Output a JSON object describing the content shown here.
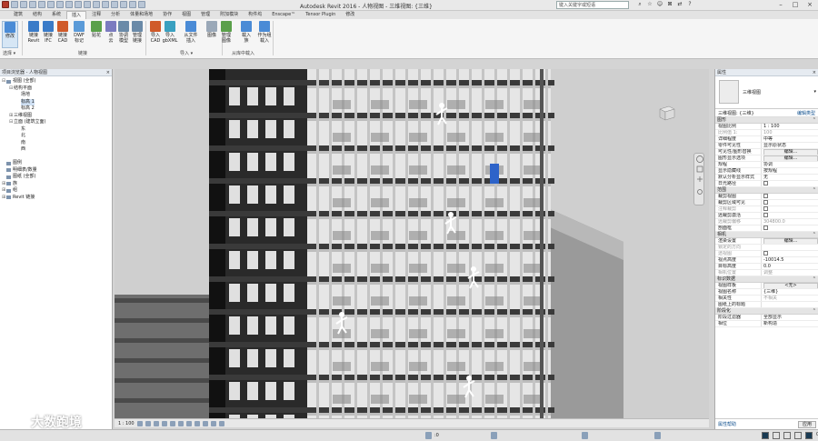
{
  "app": {
    "title": "Autodesk Revit 2016 -     人物视图 - 三维视图: {三维}",
    "search_placeholder": "键入关键字或短语",
    "window_controls": [
      "–",
      "□",
      "×"
    ]
  },
  "tabs": [
    "建筑",
    "结构",
    "系统",
    "插入",
    "注释",
    "分析",
    "体量和场地",
    "协作",
    "视图",
    "管理",
    "附加模块",
    "构件坞",
    "Enscape™",
    "Tensor Plugin",
    "修改"
  ],
  "active_tab_index": 3,
  "ribbon": {
    "buttons": [
      {
        "label": "修改",
        "icon": "modify-icon",
        "color": "#4a8bd6",
        "selected": true
      },
      {
        "label": "链接\nRevit",
        "icon": "link-revit-icon",
        "color": "#3a7bc8"
      },
      {
        "label": "链接\nIFC",
        "icon": "link-ifc-icon",
        "color": "#3a7bc8"
      },
      {
        "label": "链接\nCAD",
        "icon": "link-cad-icon",
        "color": "#d05a2a"
      },
      {
        "label": "DWF\n标记",
        "icon": "dwf-markup-icon",
        "color": "#5a9ad8"
      },
      {
        "label": "贴花",
        "icon": "decal-icon",
        "color": "#5aa04a"
      },
      {
        "label": "点\n云",
        "icon": "point-cloud-icon",
        "color": "#7b7bc0"
      },
      {
        "label": "协调\n模型",
        "icon": "coordination-model-icon",
        "color": "#6a8aa8"
      },
      {
        "label": "管理\n链接",
        "icon": "manage-links-icon",
        "color": "#6a8aa8"
      },
      {
        "label": "导入\nCAD",
        "icon": "import-cad-icon",
        "color": "#d05a2a"
      },
      {
        "label": "导入\ngbXML",
        "icon": "import-gbxml-icon",
        "color": "#3aa0c0"
      },
      {
        "label": "从文件\n插入",
        "icon": "insert-from-file-icon",
        "color": "#4a8bd6"
      },
      {
        "label": "图像",
        "icon": "image-icon",
        "color": "#9aa8b8"
      },
      {
        "label": "管理\n图像",
        "icon": "manage-images-icon",
        "color": "#5aa04a"
      },
      {
        "label": "载入\n族",
        "icon": "load-family-icon",
        "color": "#4a8bd6"
      },
      {
        "label": "作为组\n载入",
        "icon": "load-as-group-icon",
        "color": "#4a8bd6"
      }
    ],
    "panels": [
      "选择 ▾",
      "链接",
      "导入 ▾",
      "从库中载入"
    ]
  },
  "browser": {
    "title": "项目浏览器 - 人物视图",
    "close": "×",
    "tree": [
      {
        "level": 0,
        "toggle": "⊟",
        "text": "视图 (全部)",
        "icon": true
      },
      {
        "level": 1,
        "toggle": "⊟",
        "text": "结构平面",
        "icon": false
      },
      {
        "level": 2,
        "toggle": "",
        "text": "场地",
        "icon": false
      },
      {
        "level": 2,
        "toggle": "",
        "text": "标高 1",
        "icon": false,
        "selected": true
      },
      {
        "level": 2,
        "toggle": "",
        "text": "标高 2",
        "icon": false
      },
      {
        "level": 1,
        "toggle": "⊞",
        "text": "三维视图",
        "icon": false
      },
      {
        "level": 1,
        "toggle": "⊟",
        "text": "立面 (建筑立面)",
        "icon": false
      },
      {
        "level": 2,
        "toggle": "",
        "text": "东",
        "icon": false
      },
      {
        "level": 2,
        "toggle": "",
        "text": "北",
        "icon": false
      },
      {
        "level": 2,
        "toggle": "",
        "text": "南",
        "icon": false
      },
      {
        "level": 2,
        "toggle": "",
        "text": "西",
        "icon": false
      },
      {
        "level": 0,
        "toggle": "",
        "text": "",
        "icon": false
      },
      {
        "level": 0,
        "toggle": "",
        "text": "图例",
        "icon": true
      },
      {
        "level": 0,
        "toggle": "",
        "text": "明细表/数量",
        "icon": true
      },
      {
        "level": 0,
        "toggle": "",
        "text": "图纸 (全部)",
        "icon": true
      },
      {
        "level": 0,
        "toggle": "⊞",
        "text": "族",
        "icon": true
      },
      {
        "level": 0,
        "toggle": "⊞",
        "text": "组",
        "icon": true
      },
      {
        "level": 0,
        "toggle": "⊞",
        "text": "Revit 链接",
        "icon": true
      }
    ]
  },
  "properties": {
    "title": "属性",
    "close": "×",
    "type_name": "三维视图",
    "instance_label": "三维视图: {三维}",
    "edit_type": "编辑类型",
    "groups": [
      {
        "name": "图形",
        "rows": [
          {
            "k": "视图比例",
            "v": "1 : 100",
            "kd": false,
            "vd": false
          },
          {
            "k": "比例值 1:",
            "v": "100",
            "kd": true,
            "vd": true
          },
          {
            "k": "详细程度",
            "v": "中等"
          },
          {
            "k": "零件可见性",
            "v": "显示原状态"
          },
          {
            "k": "可见性/图形替换",
            "v": "编辑...",
            "btn": true
          },
          {
            "k": "图形显示选项",
            "v": "编辑...",
            "btn": true
          },
          {
            "k": "规程",
            "v": "协调"
          },
          {
            "k": "显示隐藏线",
            "v": "按规程"
          },
          {
            "k": "默认分析显示样式",
            "v": "无"
          },
          {
            "k": "日光路径",
            "v": "",
            "cb": true
          }
        ]
      },
      {
        "name": "范围",
        "rows": [
          {
            "k": "裁剪视图",
            "v": "",
            "cb": true
          },
          {
            "k": "裁剪区域可见",
            "v": "",
            "cb": true
          },
          {
            "k": "注释裁剪",
            "v": "",
            "cb": true,
            "kd": true
          },
          {
            "k": "远裁剪激活",
            "v": "",
            "cb": true
          },
          {
            "k": "远裁剪偏移",
            "v": "304800.0",
            "kd": true,
            "vd": true
          },
          {
            "k": "剖面框",
            "v": "",
            "cb": true
          }
        ]
      },
      {
        "name": "相机",
        "rows": [
          {
            "k": "渲染设置",
            "v": "编辑...",
            "btn": true
          },
          {
            "k": "锁定的方向",
            "v": "",
            "kd": true
          },
          {
            "k": "透视图",
            "v": "",
            "cb": true,
            "kd": true
          },
          {
            "k": "视点高度",
            "v": "-10014.5"
          },
          {
            "k": "目标高度",
            "v": "0.0"
          },
          {
            "k": "相机位置",
            "v": "调整",
            "kd": true,
            "vd": true
          }
        ]
      },
      {
        "name": "标识数据",
        "rows": [
          {
            "k": "视图样板",
            "v": "<无>",
            "btn": true
          },
          {
            "k": "视图名称",
            "v": "{三维}"
          },
          {
            "k": "相关性",
            "v": "不相关",
            "vd": true
          },
          {
            "k": "图纸上的标题",
            "v": ""
          }
        ]
      },
      {
        "name": "阶段化",
        "rows": [
          {
            "k": "阶段过滤器",
            "v": "全部显示"
          },
          {
            "k": "相位",
            "v": "新构造"
          }
        ]
      }
    ],
    "help_link": "属性帮助",
    "apply": "应用"
  },
  "view_control": {
    "scale": "1 : 100"
  },
  "statusbar": {
    "counter": ":0",
    "filter_count": "0"
  },
  "watermark": "大数跑境"
}
